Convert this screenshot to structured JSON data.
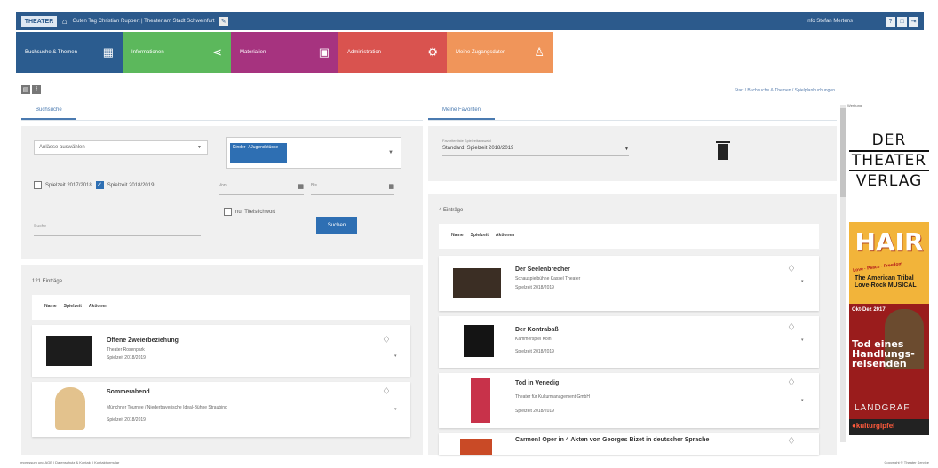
{
  "topbar": {
    "logo": "THEATER",
    "breadcrumb": "Guten Tag Christian Ruppert | Theater am Stadt Schweinfurt",
    "user": "Info Stefan Mertens",
    "icons": [
      "help-icon",
      "window-icon",
      "logout-icon"
    ]
  },
  "tiles": [
    {
      "label": "Buchsuche & Themen",
      "color": "#2b5c8f",
      "icon": "calendar-icon",
      "glyph": "▦"
    },
    {
      "label": "Informationen",
      "color": "#5cb85c",
      "icon": "share-icon",
      "glyph": "⋖"
    },
    {
      "label": "Materialien",
      "color": "#a6337f",
      "icon": "image-icon",
      "glyph": "▣"
    },
    {
      "label": "Administration",
      "color": "#d9534f",
      "icon": "gear-icon",
      "glyph": "⚙"
    },
    {
      "label": "Meine Zugangsdaten",
      "color": "#f0955a",
      "icon": "user-icon",
      "glyph": "♙"
    }
  ],
  "breadcrumb": "Start / Buchsuche & Themen / Spielplanbuchungen",
  "left": {
    "tab": "Buchsuche",
    "select_placeholder": "Anlässe auswählen",
    "chip_label": "Kinder- / Jugendstücke",
    "checkbox1": "Spielzeit 2017/2018",
    "checkbox2": "Spielzeit 2018/2019",
    "date_from": "Von",
    "date_to": "Bis",
    "only_free": "nur Titelstichwort",
    "search_placeholder": "Suche",
    "search_button": "Suchen",
    "count": "121 Einträge",
    "header": {
      "name": "Name",
      "season": "Spielzeit",
      "actions": "Aktionen"
    },
    "items": [
      {
        "title": "Offene Zweierbeziehung",
        "company": "Theater Rosenpark",
        "season": "Spielzeit 2018/2019"
      },
      {
        "title": "Sommerabend",
        "company": "Münchner Tournee / Niederbayerische Ideal-Bühne Straubing",
        "season": "Spielzeit 2018/2019"
      }
    ]
  },
  "right": {
    "tab": "Meine Favoriten",
    "select_label": "Favoritenliste Spielzeitauswahl",
    "select_value": "Standard: Spielzeit 2018/2019",
    "count": "4 Einträge",
    "header": {
      "name": "Name",
      "season": "Spielzeit",
      "actions": "Aktionen"
    },
    "items": [
      {
        "title": "Der Seelenbrecher",
        "company": "Schauspielbühne Kassel Theater",
        "season": "Spielzeit 2018/2019"
      },
      {
        "title": "Der Kontrabaß",
        "company": "Kammerspiel Köln",
        "season": "Spielzeit 2018/2019"
      },
      {
        "title": "Tod in Venedig",
        "company": "Theater für Kulturmanagement GmbH",
        "season": "Spielzeit 2018/2019"
      },
      {
        "title": "Carmen! Oper in 4 Akten von Georges Bizet in deutscher Sprache",
        "company": "",
        "season": ""
      }
    ]
  },
  "ad": {
    "label": "Werbung",
    "logo_l1": "DER",
    "logo_l2": "THEATER",
    "logo_l3": "VERLAG",
    "hair_title": "HAIR",
    "hair_sub1": "Love · Peace · Freedom",
    "hair_sub2": "The American Tribal Love-Rock MUSICAL",
    "tod_date": "Okt-Dez 2017",
    "tod_text": "Tod eines Handlungs-reisenden",
    "tod_brand": "LANDGRAF",
    "kultur": "●kulturgipfel"
  },
  "footer": "Impressum und AGB | Datenschutz & Kontakt | Kontaktformular",
  "footer_right": "Copyright © Theater Service"
}
